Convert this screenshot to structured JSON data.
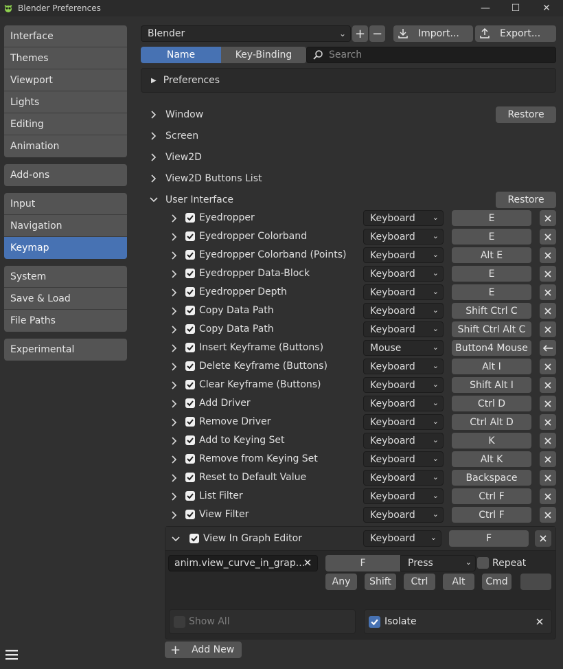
{
  "window": {
    "title": "Blender Preferences",
    "minimize": "—",
    "maximize": "☐",
    "close": "✕"
  },
  "sidebar": {
    "groups": [
      [
        {
          "label": "Interface"
        },
        {
          "label": "Themes"
        },
        {
          "label": "Viewport"
        },
        {
          "label": "Lights"
        },
        {
          "label": "Editing"
        },
        {
          "label": "Animation"
        }
      ],
      [
        {
          "label": "Add-ons"
        }
      ],
      [
        {
          "label": "Input"
        },
        {
          "label": "Navigation"
        },
        {
          "label": "Keymap",
          "active": true
        }
      ],
      [
        {
          "label": "System"
        },
        {
          "label": "Save & Load"
        },
        {
          "label": "File Paths"
        }
      ],
      [
        {
          "label": "Experimental"
        }
      ]
    ]
  },
  "toolbar": {
    "preset": "Blender",
    "add": "+",
    "remove": "−",
    "import_label": "Import...",
    "export_label": "Export..."
  },
  "tabs": {
    "name": "Name",
    "key_binding": "Key-Binding",
    "search_placeholder": "Search"
  },
  "preferences_panel": {
    "label": "Preferences"
  },
  "categories": [
    {
      "label": "Window",
      "restore": "Restore",
      "expanded": false
    },
    {
      "label": "Screen",
      "expanded": false
    },
    {
      "label": "View2D",
      "expanded": false
    },
    {
      "label": "View2D Buttons List",
      "expanded": false
    },
    {
      "label": "User Interface",
      "restore": "Restore",
      "expanded": true
    }
  ],
  "items": [
    {
      "name": "Eyedropper",
      "type": "Keyboard",
      "key": "E",
      "action": "remove"
    },
    {
      "name": "Eyedropper Colorband",
      "type": "Keyboard",
      "key": "E",
      "action": "remove"
    },
    {
      "name": "Eyedropper Colorband (Points)",
      "type": "Keyboard",
      "key": "Alt E",
      "action": "remove"
    },
    {
      "name": "Eyedropper Data-Block",
      "type": "Keyboard",
      "key": "E",
      "action": "remove"
    },
    {
      "name": "Eyedropper Depth",
      "type": "Keyboard",
      "key": "E",
      "action": "remove"
    },
    {
      "name": "Copy Data Path",
      "type": "Keyboard",
      "key": "Shift Ctrl C",
      "action": "remove"
    },
    {
      "name": "Copy Data Path",
      "type": "Keyboard",
      "key": "Shift Ctrl Alt C",
      "action": "remove"
    },
    {
      "name": "Insert Keyframe (Buttons)",
      "type": "Mouse",
      "key": "Button4 Mouse",
      "action": "restore"
    },
    {
      "name": "Delete Keyframe (Buttons)",
      "type": "Keyboard",
      "key": "Alt I",
      "action": "remove"
    },
    {
      "name": "Clear Keyframe (Buttons)",
      "type": "Keyboard",
      "key": "Shift Alt I",
      "action": "remove"
    },
    {
      "name": "Add Driver",
      "type": "Keyboard",
      "key": "Ctrl D",
      "action": "remove"
    },
    {
      "name": "Remove Driver",
      "type": "Keyboard",
      "key": "Ctrl Alt D",
      "action": "remove"
    },
    {
      "name": "Add to Keying Set",
      "type": "Keyboard",
      "key": "K",
      "action": "remove"
    },
    {
      "name": "Remove from Keying Set",
      "type": "Keyboard",
      "key": "Alt K",
      "action": "remove"
    },
    {
      "name": "Reset to Default Value",
      "type": "Keyboard",
      "key": "Backspace",
      "action": "remove"
    },
    {
      "name": "List Filter",
      "type": "Keyboard",
      "key": "Ctrl F",
      "action": "remove"
    },
    {
      "name": "View Filter",
      "type": "Keyboard",
      "key": "Ctrl F",
      "action": "remove"
    }
  ],
  "expanded_item": {
    "name": "View In Graph Editor",
    "type": "Keyboard",
    "key": "F",
    "operator": "anim.view_curve_in_grap...",
    "event_key": "F",
    "event_value": "Press",
    "repeat_label": "Repeat",
    "modifiers": [
      "Any",
      "Shift",
      "Ctrl",
      "Alt",
      "Cmd"
    ]
  },
  "footer": {
    "show_all": "Show All",
    "isolate": "Isolate",
    "add_new": "Add New"
  },
  "colors": {
    "accent": "#4772b3",
    "background": "#303030",
    "button": "#545454",
    "field": "#282828"
  }
}
